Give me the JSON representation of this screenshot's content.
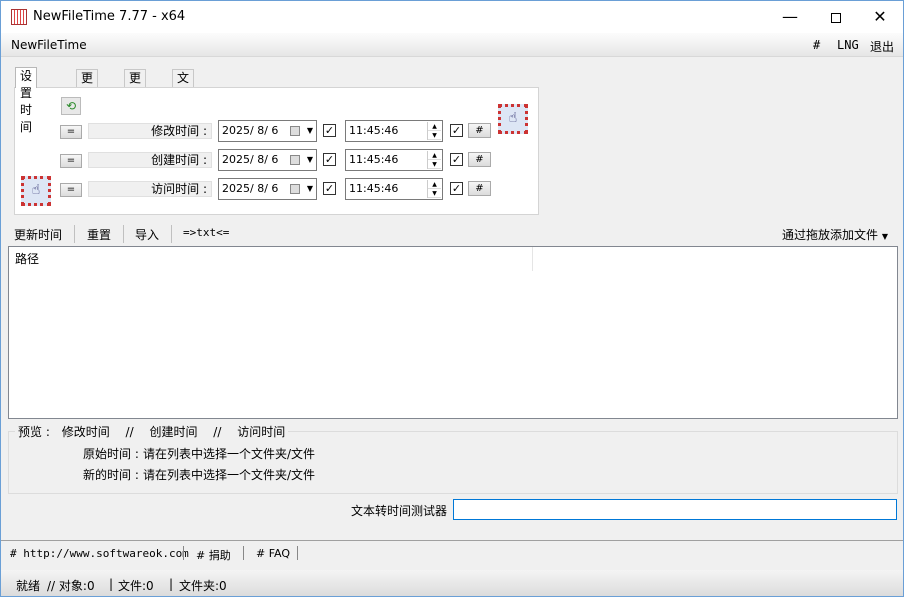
{
  "window": {
    "title": "NewFileTime 7.77 - x64",
    "min": "—",
    "close": "✕"
  },
  "menubar": {
    "app_label": "NewFileTime",
    "hash": "#",
    "lng": "LNG",
    "exit": "退出"
  },
  "tabs": [
    "设置时间",
    "更早些",
    "更晚些",
    "文件名转时间"
  ],
  "time_rows": [
    {
      "eq": "=",
      "label": "修改时间 :",
      "date": "2025/ 8/ 6",
      "time": "11:45:46",
      "checked": "✓",
      "hash": "#"
    },
    {
      "eq": "=",
      "label": "创建时间 :",
      "date": "2025/ 8/ 6",
      "time": "11:45:46",
      "checked": "✓",
      "hash": "#"
    },
    {
      "eq": "=",
      "label": "访问时间 :",
      "date": "2025/ 8/ 6",
      "time": "11:45:46",
      "checked": "✓",
      "hash": "#"
    }
  ],
  "toolbar": {
    "update": "更新时间",
    "reset": "重置",
    "import": "导入",
    "txt": "=>txt<=",
    "drag_add": "通过拖放添加文件"
  },
  "list": {
    "col_path": "路径"
  },
  "preview": {
    "header_label": "预览 :",
    "opt_modified": "修改时间",
    "sep1": "//",
    "opt_created": "创建时间",
    "sep2": "//",
    "opt_accessed": "访问时间",
    "orig_label": "原始时间 :",
    "orig_value": "请在列表中选择一个文件夹/文件",
    "new_label": "新的时间 :",
    "new_value": "请在列表中选择一个文件夹/文件"
  },
  "tester": {
    "label": "文本转时间测试器",
    "value": ""
  },
  "links": {
    "website": "# http://www.softwareok.com",
    "donate": "# 捐助",
    "faq": "# FAQ"
  },
  "status": {
    "ready": "就绪",
    "objects": "// 对象:0",
    "files": "文件:0",
    "folders": "文件夹:0"
  },
  "colors": {
    "window_border": "#6a9fd6",
    "accent_input": "#0078d7",
    "reset_icon": "#2a8a2a"
  }
}
